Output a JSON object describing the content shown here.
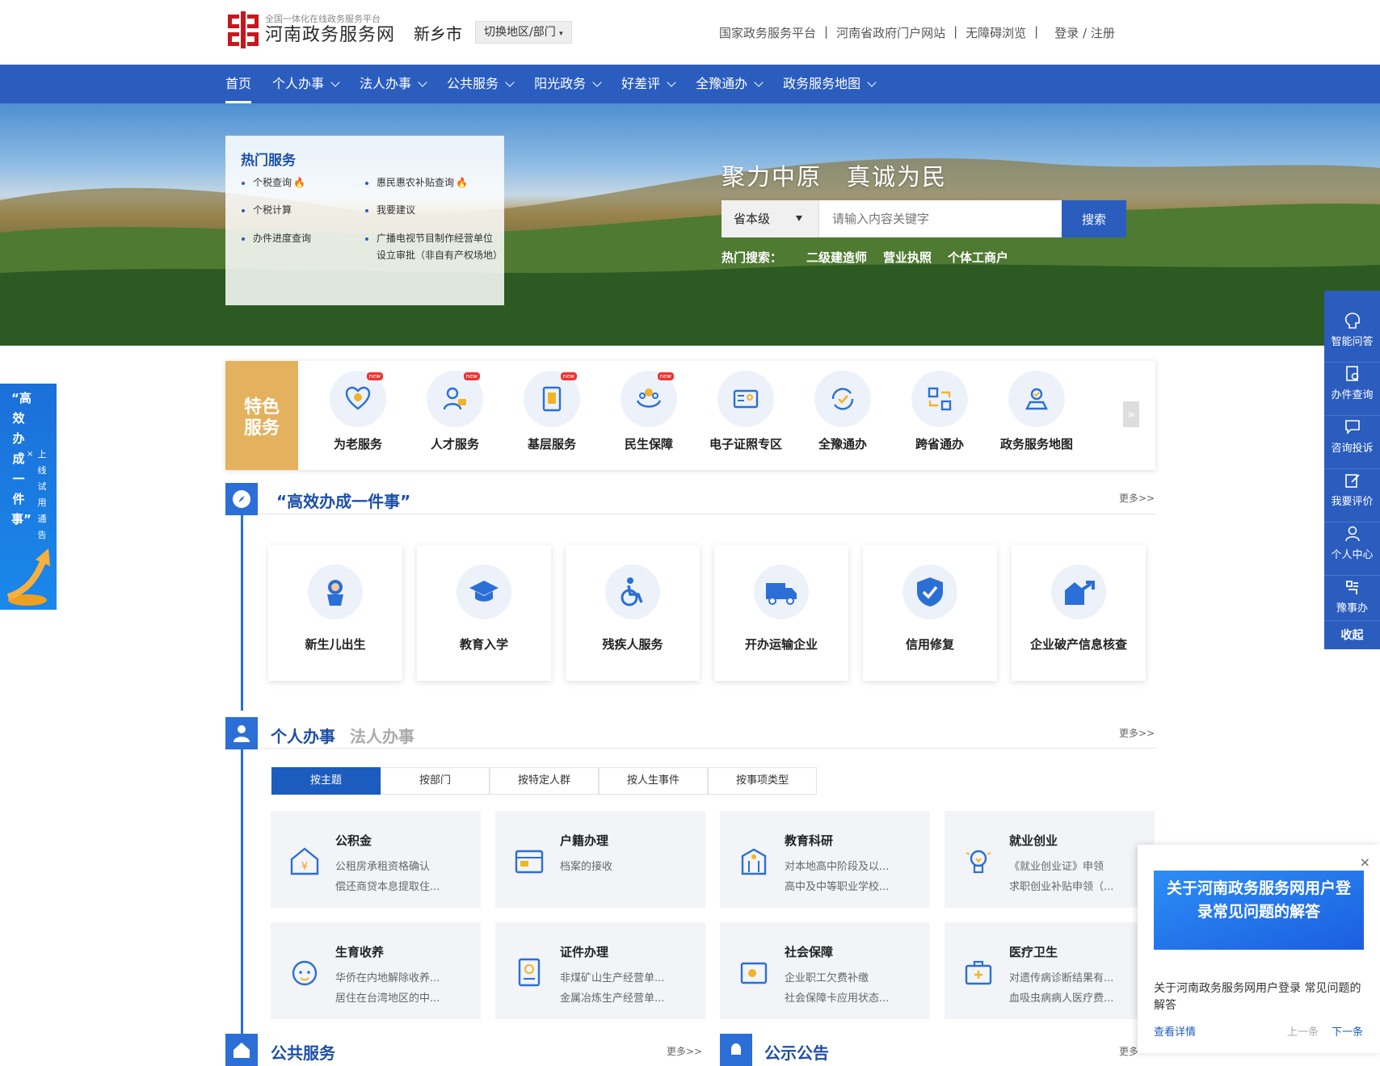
{
  "header": {
    "logo_sub": "全国一体化在线政务服务平台",
    "logo_main": "河南政务服务网",
    "city": "新乡市",
    "switch_label": "切换地区/部门",
    "links": [
      "国家政务服务平台",
      "河南省政府门户网站",
      "无障碍浏览",
      "登录 / 注册"
    ]
  },
  "nav": {
    "items": [
      "首页",
      "个人办事",
      "法人办事",
      "公共服务",
      "阳光政务",
      "好差评",
      "全豫通办",
      "政务服务地图"
    ]
  },
  "hot": {
    "title": "热门服务",
    "items": [
      "个税查询",
      "惠民惠农补贴查询",
      "个税计算",
      "我要建议",
      "办件进度查询",
      "广播电视节目制作经营单位设立审批（非自有产权场地）"
    ]
  },
  "search": {
    "slogan": "聚力中原　真诚为民",
    "level": "省本级",
    "placeholder": "请输入内容关键字",
    "button": "搜索",
    "hot_label": "热门搜索：",
    "hot_terms": [
      "二级建造师",
      "营业执照",
      "个体工商户"
    ]
  },
  "features": {
    "tag": "特色服务",
    "badge": "new",
    "items": [
      "为老服务",
      "人才服务",
      "基层服务",
      "民生保障",
      "电子证照专区",
      "全豫通办",
      "跨省通办",
      "政务服务地图"
    ]
  },
  "efficient": {
    "title": "“高效办成一件事”",
    "more": "更多>>",
    "items": [
      "新生儿出生",
      "教育入学",
      "残疾人服务",
      "开办运输企业",
      "信用修复",
      "企业破产信息核查"
    ]
  },
  "personal": {
    "title": "个人办事",
    "alt_title": "法人办事",
    "more": "更多>>",
    "tabs": [
      "按主题",
      "按部门",
      "按特定人群",
      "按人生事件",
      "按事项类型"
    ],
    "cards": [
      {
        "name": "公积金",
        "l1": "公租房承租资格确认",
        "l2": "偿还商贷本息提取住..."
      },
      {
        "name": "户籍办理",
        "l1": "档案的接收",
        "l2": ""
      },
      {
        "name": "教育科研",
        "l1": "对本地高中阶段及以...",
        "l2": "高中及中等职业学校..."
      },
      {
        "name": "就业创业",
        "l1": "《就业创业证》申领",
        "l2": "求职创业补贴申领（..."
      },
      {
        "name": "生育收养",
        "l1": "华侨在内地解除收养...",
        "l2": "居住在台湾地区的中..."
      },
      {
        "name": "证件办理",
        "l1": "非煤矿山生产经营单...",
        "l2": "金属冶炼生产经营单..."
      },
      {
        "name": "社会保障",
        "l1": "企业职工欠费补缴",
        "l2": "社会保障卡应用状态..."
      },
      {
        "name": "医疗卫生",
        "l1": "对遗传病诊断结果有...",
        "l2": "血吸虫病病人医疗费..."
      }
    ]
  },
  "bottom": {
    "public_title": "公共服务",
    "public_more": "更多>>",
    "notice_title": "公示公告",
    "notice_more": "更多"
  },
  "left_banner": {
    "big": "“高效办成一件事”",
    "small": "上线试用通告"
  },
  "right_bar": {
    "items": [
      "智能问答",
      "办件查询",
      "咨询投诉",
      "我要评价",
      "个人中心",
      "豫事办"
    ],
    "collapse": "收起"
  },
  "notice_popup": {
    "image_text": "关于河南政务服务网用户登录常见问题的解答",
    "text": "关于河南政务服务网用户登录 常见问题的解答",
    "link": "查看详情",
    "prev": "上一条",
    "next": "下一条",
    "close": "×"
  },
  "colors": {
    "primary": "#2b5dbf",
    "accent_gold": "#e4b25e",
    "section_blue": "#2b6fd6"
  }
}
